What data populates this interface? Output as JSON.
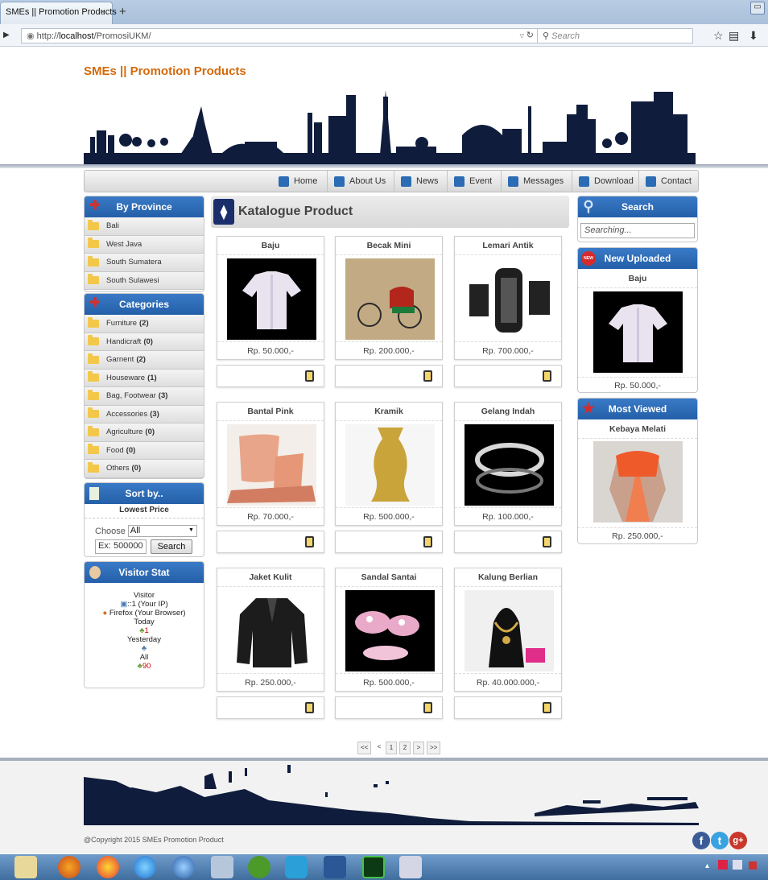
{
  "browser": {
    "tab_title": "SMEs || Promotion Products",
    "tab_close": "×",
    "new_tab": "+",
    "url_prefix": "http://",
    "url_host": "localhost",
    "url_path": "/PromosiUKM/",
    "search_placeholder": "Search"
  },
  "site": {
    "title": "SMEs || Promotion Products",
    "copyright": "@Copyright 2015 SMEs Promotion Product"
  },
  "menu": [
    "Home",
    "About Us",
    "News",
    "Event",
    "Messages",
    "Download",
    "Contact"
  ],
  "province": {
    "heading": "By Province",
    "items": [
      "Bali",
      "West Java",
      "South Sumatera",
      "South Sulawesi"
    ]
  },
  "categories": {
    "heading": "Categories",
    "items": [
      {
        "name": "Furniture",
        "count": "(2)"
      },
      {
        "name": "Handicraft",
        "count": "(0)"
      },
      {
        "name": "Garnent",
        "count": "(2)"
      },
      {
        "name": "Houseware",
        "count": "(1)"
      },
      {
        "name": "Bag, Footwear",
        "count": "(3)"
      },
      {
        "name": "Accessories",
        "count": "(3)"
      },
      {
        "name": "Agriculture",
        "count": "(0)"
      },
      {
        "name": "Food",
        "count": "(0)"
      },
      {
        "name": "Others",
        "count": "(0)"
      }
    ]
  },
  "sort": {
    "heading": "Sort by..",
    "sub": "Lowest Price",
    "choose_label": "Choose",
    "choose_value": "All",
    "input_placeholder": "Ex: 500000",
    "button": "Search"
  },
  "visitor": {
    "heading": "Visitor Stat",
    "visitor_label": "Visitor",
    "ip": "::1 (Your IP)",
    "browser": "Firefox (Your Browser)",
    "today_label": "Today",
    "today": "1",
    "yesterday_label": "Yesterday",
    "all_label": "All",
    "all": "90"
  },
  "catalogue": {
    "heading": "Katalogue Product",
    "products": [
      {
        "name": "Baju",
        "price": "Rp. 50.000,-"
      },
      {
        "name": "Becak Mini",
        "price": "Rp. 200.000,-"
      },
      {
        "name": "Lemari Antik",
        "price": "Rp. 700.000,-"
      },
      {
        "name": "Bantal Pink",
        "price": "Rp. 70.000,-"
      },
      {
        "name": "Kramik",
        "price": "Rp. 500.000,-"
      },
      {
        "name": "Gelang Indah",
        "price": "Rp. 100.000,-"
      },
      {
        "name": "Jaket Kulit",
        "price": "Rp. 250.000,-"
      },
      {
        "name": "Sandal Santai",
        "price": "Rp. 500.000,-"
      },
      {
        "name": "Kalung Berlian",
        "price": "Rp. 40.000.000,-"
      }
    ]
  },
  "pagination": [
    "<<",
    "<",
    "1",
    "2",
    ">",
    ">>"
  ],
  "right": {
    "search_heading": "Search",
    "search_placeholder": "Searching...",
    "new_heading": "New Uploaded",
    "new_badge": "NEW",
    "new_name": "Baju",
    "new_price": "Rp. 50.000,-",
    "viewed_heading": "Most Viewed",
    "viewed_name": "Kebaya Melati",
    "viewed_price": "Rp. 250.000,-"
  }
}
